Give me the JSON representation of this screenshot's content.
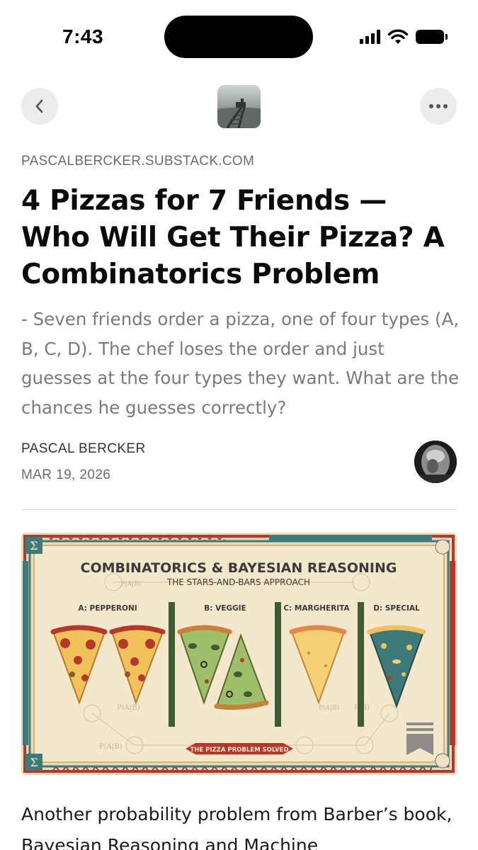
{
  "status_bar": {
    "time": "7:43"
  },
  "nav": {
    "back_icon": "chevron-left-icon",
    "more_icon": "ellipsis-icon"
  },
  "article": {
    "domain": "PASCALBERCKER.SUBSTACK.COM",
    "title": "4 Pizzas for 7 Friends — Who Will Get Their Pizza? A Combinatorics Problem",
    "subtitle": "- Seven friends order a pizza, one of four types (A, B, C, D). The chef loses the order and just guesses at the four types they want. What are the chances he guesses correctly?",
    "author": "PASCAL BERCKER",
    "date": "MAR 19, 2026",
    "body_start": "Another probability problem from Barber’s book, Bayesian Reasoning and Machine"
  },
  "cover": {
    "heading": "COMBINATORICS & BAYESIAN REASONING",
    "subheading": "THE STARS-AND-BARS APPROACH",
    "labels": [
      "A: PEPPERONI",
      "B: VEGGIE",
      "C: MARGHERITA",
      "D: SPECIAL"
    ],
    "banner": "THE PIZZA PROBLEM SOLVED",
    "corner_symbols": [
      "Σ",
      "Σ"
    ],
    "formula_labels": [
      "P(A|B)",
      "P(A|B)",
      "P(A|B)",
      "P(A|B)",
      "P(B)"
    ]
  },
  "colors": {
    "accent_red": "#b5382b",
    "accent_teal": "#3e7a7a",
    "paper": "#f3e7cc",
    "bar_green": "#3f5a34"
  }
}
